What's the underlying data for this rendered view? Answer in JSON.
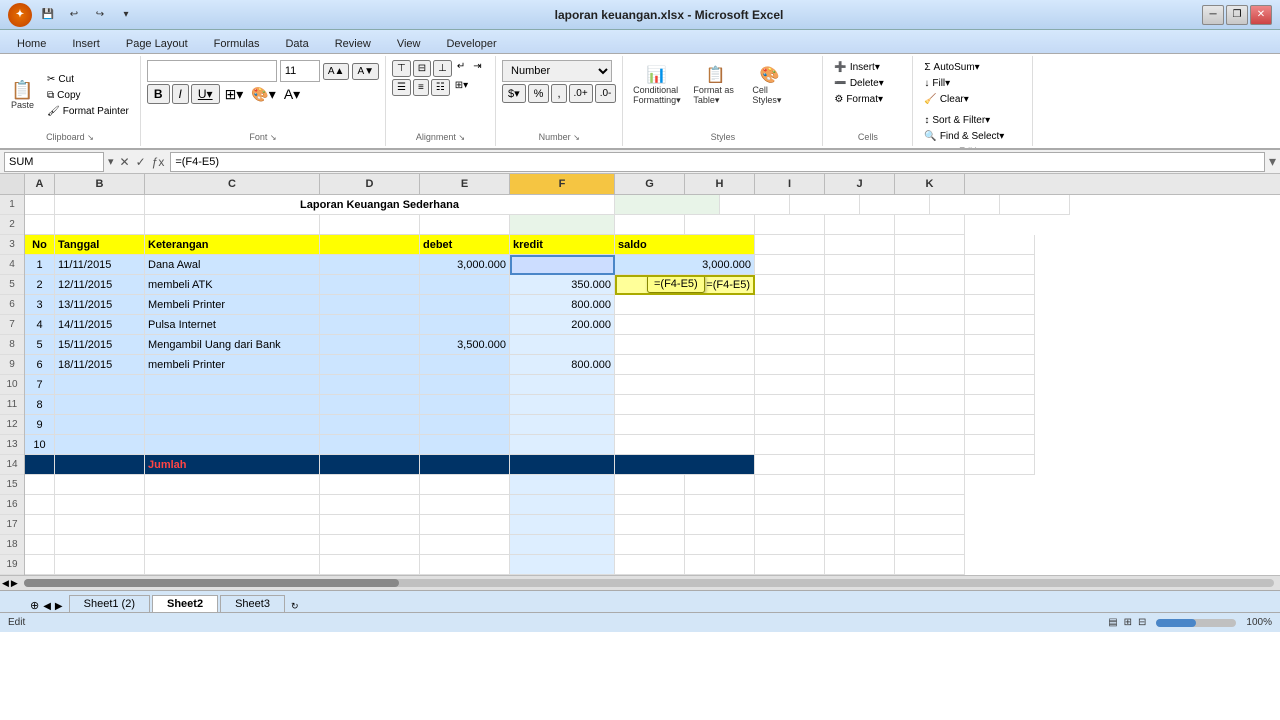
{
  "titlebar": {
    "title": "laporan keuangan.xlsx - Microsoft Excel",
    "min_label": "─",
    "restore_label": "❐",
    "close_label": "✕"
  },
  "ribbon": {
    "tabs": [
      "Home",
      "Insert",
      "Page Layout",
      "Formulas",
      "Data",
      "Review",
      "View",
      "Developer"
    ],
    "active_tab": "Home",
    "groups": {
      "clipboard": "Clipboard",
      "font": "Font",
      "alignment": "Alignment",
      "number": "Number",
      "styles": "Styles",
      "cells": "Cells",
      "editing": "Editing"
    }
  },
  "formulabar": {
    "name_box": "SUM",
    "formula": "=(F4-E5)"
  },
  "spreadsheet": {
    "col_headers": [
      "A",
      "B",
      "C",
      "D",
      "E",
      "F",
      "G",
      "H",
      "I",
      "J",
      "K"
    ],
    "active_col": "F",
    "rows": [
      {
        "num": 1,
        "cells": [
          {
            "col": "A",
            "val": ""
          },
          {
            "col": "B",
            "val": ""
          },
          {
            "col": "C",
            "val": "Laporan Keuangan Sederhana",
            "style": "bold center merged"
          },
          {
            "col": "D",
            "val": ""
          },
          {
            "col": "E",
            "val": ""
          },
          {
            "col": "F",
            "val": ""
          },
          {
            "col": "G",
            "val": ""
          },
          {
            "col": "H",
            "val": ""
          },
          {
            "col": "I",
            "val": ""
          },
          {
            "col": "J",
            "val": ""
          },
          {
            "col": "K",
            "val": ""
          }
        ]
      },
      {
        "num": 2,
        "cells": []
      },
      {
        "num": 3,
        "cells": [
          {
            "col": "A",
            "val": "No",
            "style": "header"
          },
          {
            "col": "B",
            "val": "Tanggal",
            "style": "header"
          },
          {
            "col": "C",
            "val": "Keterangan",
            "style": "header"
          },
          {
            "col": "D",
            "val": ""
          },
          {
            "col": "E",
            "val": "debet",
            "style": "header"
          },
          {
            "col": "F",
            "val": "kredit",
            "style": "header"
          },
          {
            "col": "G",
            "val": "saldo",
            "style": "header merged"
          }
        ]
      },
      {
        "num": 4,
        "cells": [
          {
            "col": "A",
            "val": "1",
            "style": "center"
          },
          {
            "col": "B",
            "val": "11/11/2015"
          },
          {
            "col": "C",
            "val": "Dana Awal"
          },
          {
            "col": "D",
            "val": ""
          },
          {
            "col": "E",
            "val": "3,000.000",
            "style": "right"
          },
          {
            "col": "F",
            "val": "",
            "style": "active-selected"
          },
          {
            "col": "G",
            "val": "3,000.000",
            "style": "right"
          }
        ]
      },
      {
        "num": 5,
        "cells": [
          {
            "col": "A",
            "val": "2",
            "style": "center"
          },
          {
            "col": "B",
            "val": "12/11/2015"
          },
          {
            "col": "C",
            "val": "membeli ATK"
          },
          {
            "col": "D",
            "val": ""
          },
          {
            "col": "E",
            "val": ""
          },
          {
            "col": "F",
            "val": "350.000",
            "style": "right"
          },
          {
            "col": "G",
            "val": "=(F4-E5)",
            "style": "formula"
          }
        ]
      },
      {
        "num": 6,
        "cells": [
          {
            "col": "A",
            "val": "3",
            "style": "center"
          },
          {
            "col": "B",
            "val": "13/11/2015"
          },
          {
            "col": "C",
            "val": "Membeli Printer"
          },
          {
            "col": "D",
            "val": ""
          },
          {
            "col": "E",
            "val": ""
          },
          {
            "col": "F",
            "val": "800.000",
            "style": "right"
          },
          {
            "col": "G",
            "val": ""
          }
        ]
      },
      {
        "num": 7,
        "cells": [
          {
            "col": "A",
            "val": "4",
            "style": "center"
          },
          {
            "col": "B",
            "val": "14/11/2015"
          },
          {
            "col": "C",
            "val": "Pulsa Internet"
          },
          {
            "col": "D",
            "val": ""
          },
          {
            "col": "E",
            "val": ""
          },
          {
            "col": "F",
            "val": "200.000",
            "style": "right"
          },
          {
            "col": "G",
            "val": ""
          }
        ]
      },
      {
        "num": 8,
        "cells": [
          {
            "col": "A",
            "val": "5",
            "style": "center"
          },
          {
            "col": "B",
            "val": "15/11/2015"
          },
          {
            "col": "C",
            "val": "Mengambil Uang dari Bank"
          },
          {
            "col": "D",
            "val": ""
          },
          {
            "col": "E",
            "val": "3,500.000",
            "style": "right"
          },
          {
            "col": "F",
            "val": ""
          },
          {
            "col": "G",
            "val": ""
          }
        ]
      },
      {
        "num": 9,
        "cells": [
          {
            "col": "A",
            "val": "6",
            "style": "center"
          },
          {
            "col": "B",
            "val": "18/11/2015"
          },
          {
            "col": "C",
            "val": "membeli Printer"
          },
          {
            "col": "D",
            "val": ""
          },
          {
            "col": "E",
            "val": ""
          },
          {
            "col": "F",
            "val": "800.000",
            "style": "right"
          },
          {
            "col": "G",
            "val": ""
          }
        ]
      },
      {
        "num": 10,
        "cells": [
          {
            "col": "A",
            "val": "7",
            "style": "center"
          },
          {
            "col": "B",
            "val": ""
          },
          {
            "col": "C",
            "val": ""
          },
          {
            "col": "D",
            "val": ""
          },
          {
            "col": "E",
            "val": ""
          },
          {
            "col": "F",
            "val": ""
          },
          {
            "col": "G",
            "val": ""
          }
        ]
      },
      {
        "num": 11,
        "cells": [
          {
            "col": "A",
            "val": "8",
            "style": "center"
          }
        ]
      },
      {
        "num": 12,
        "cells": [
          {
            "col": "A",
            "val": "9",
            "style": "center"
          }
        ]
      },
      {
        "num": 13,
        "cells": [
          {
            "col": "A",
            "val": "10",
            "style": "center"
          }
        ]
      },
      {
        "num": 14,
        "cells": [
          {
            "col": "A",
            "val": "",
            "style": "dark"
          },
          {
            "col": "B",
            "val": "",
            "style": "dark"
          },
          {
            "col": "C",
            "val": "Jumlah",
            "style": "dark-red"
          },
          {
            "col": "D",
            "val": "",
            "style": "dark"
          },
          {
            "col": "E",
            "val": "",
            "style": "dark"
          },
          {
            "col": "F",
            "val": "",
            "style": "dark"
          },
          {
            "col": "G",
            "val": "",
            "style": "dark"
          }
        ]
      },
      {
        "num": 15,
        "cells": []
      },
      {
        "num": 16,
        "cells": []
      },
      {
        "num": 17,
        "cells": []
      },
      {
        "num": 18,
        "cells": []
      },
      {
        "num": 19,
        "cells": []
      }
    ]
  },
  "sheet_tabs": [
    "Sheet1 (2)",
    "Sheet2",
    "Sheet3"
  ],
  "active_sheet": "Sheet2",
  "statusbar": {
    "mode": "Edit",
    "zoom": "100%"
  }
}
